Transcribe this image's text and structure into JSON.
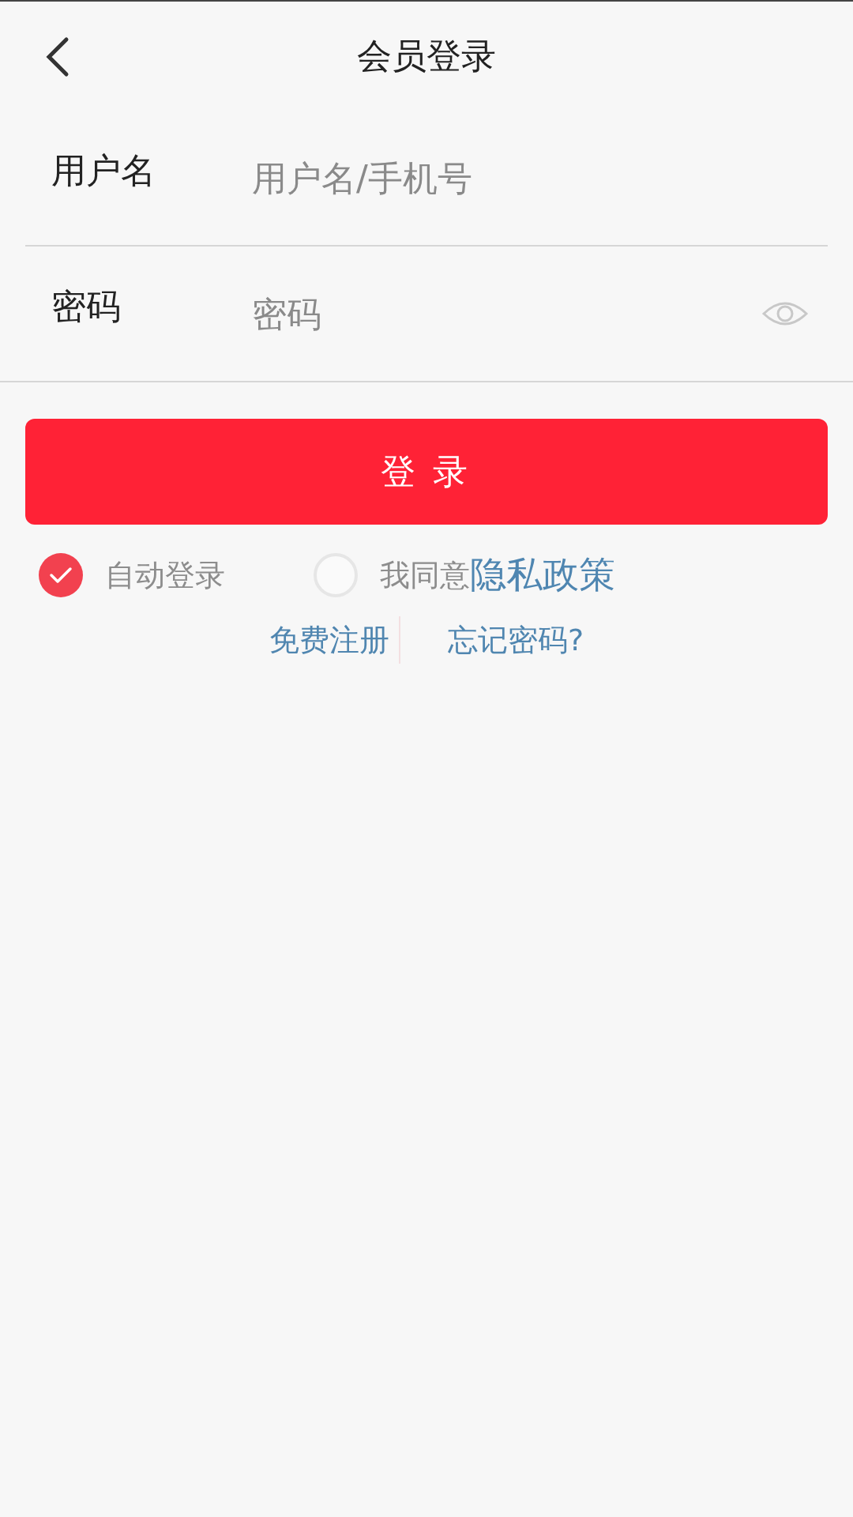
{
  "header": {
    "title": "会员登录"
  },
  "fields": [
    {
      "label": "用户名",
      "placeholder": "用户名/手机号",
      "kind": "text"
    },
    {
      "label": "密码",
      "placeholder": "密码",
      "kind": "password"
    }
  ],
  "login_button": {
    "label": "登录"
  },
  "options": [
    {
      "label": "自动登录",
      "checked": true
    },
    {
      "label": "我同意",
      "link": "隐私政策",
      "checked": false
    }
  ],
  "links": [
    "免费注册",
    "忘记密码?"
  ]
}
